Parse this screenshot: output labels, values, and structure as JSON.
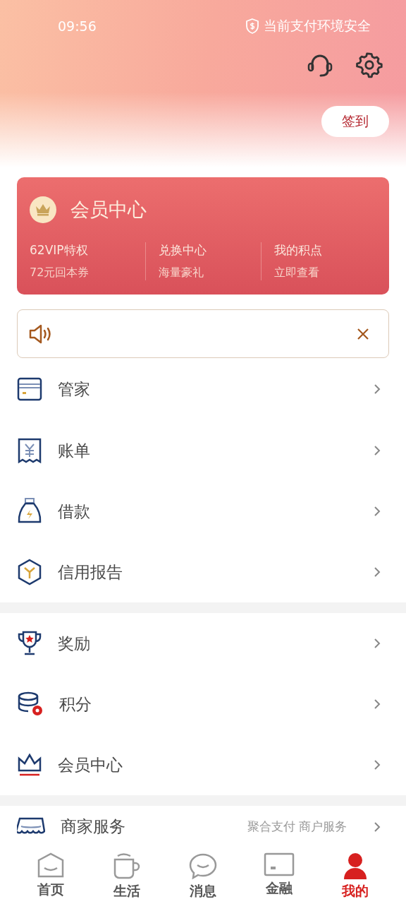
{
  "status_bar": {
    "time": "09:56",
    "security": "当前支付环境安全"
  },
  "checkin": {
    "label": "签到"
  },
  "member_card": {
    "title": "会员中心",
    "perks": [
      {
        "title": "62VIP特权",
        "subtitle": "72元回本券"
      },
      {
        "title": "兑换中心",
        "subtitle": "海量豪礼"
      },
      {
        "title": "我的积点",
        "subtitle": "立即查看"
      }
    ]
  },
  "notice": {
    "visible": true
  },
  "sections": [
    {
      "items": [
        {
          "label": "管家"
        },
        {
          "label": "账单"
        },
        {
          "label": "借款"
        },
        {
          "label": "信用报告"
        }
      ]
    },
    {
      "items": [
        {
          "label": "奖励"
        },
        {
          "label": "积分"
        },
        {
          "label": "会员中心"
        }
      ]
    },
    {
      "items": [
        {
          "label": "商家服务",
          "hint": "聚合支付 商户服务"
        }
      ]
    }
  ],
  "tabs": [
    {
      "label": "首页",
      "selected": false
    },
    {
      "label": "生活",
      "selected": false
    },
    {
      "label": "消息",
      "selected": false
    },
    {
      "label": "金融",
      "selected": false
    },
    {
      "label": "我的",
      "selected": true
    }
  ]
}
